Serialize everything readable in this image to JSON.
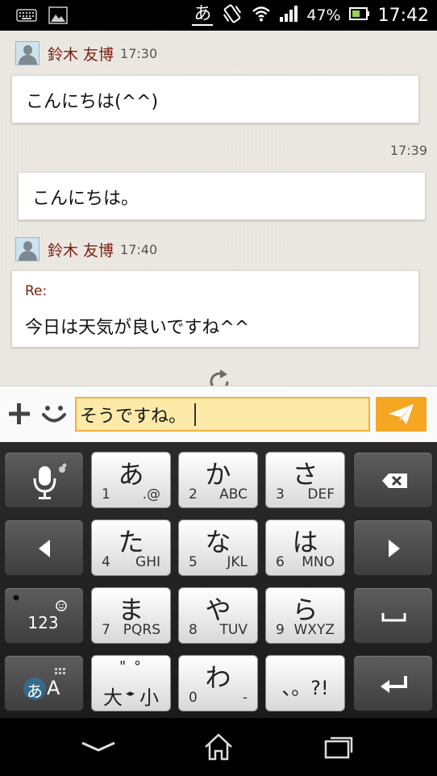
{
  "status_bar": {
    "ime_indicator": "あ",
    "battery_percent": "47%",
    "time": "17:42",
    "icons": [
      "keyboard-icon",
      "image-icon",
      "vibrate-icon",
      "wifi-icon",
      "signal-icon",
      "battery-icon"
    ]
  },
  "chat": {
    "messages": [
      {
        "sender": "鈴木 友博",
        "time": "17:30",
        "text": "こんにちは(^^)",
        "direction": "incoming"
      },
      {
        "time": "17:39",
        "text": "こんにちは。",
        "direction": "outgoing"
      },
      {
        "sender": "鈴木 友博",
        "time": "17:40",
        "reply_label": "Re:",
        "text": "今日は天気が良いですね^^",
        "direction": "incoming"
      }
    ]
  },
  "input": {
    "value": "そうですね。"
  },
  "keyboard": {
    "keys": [
      {
        "kana": "あ",
        "num": "1",
        "sub": ".@"
      },
      {
        "kana": "か",
        "num": "2",
        "sub": "ABC"
      },
      {
        "kana": "さ",
        "num": "3",
        "sub": "DEF"
      },
      {
        "kana": "た",
        "num": "4",
        "sub": "GHI"
      },
      {
        "kana": "な",
        "num": "5",
        "sub": "JKL"
      },
      {
        "kana": "は",
        "num": "6",
        "sub": "MNO"
      },
      {
        "kana": "ま",
        "num": "7",
        "sub": "PQRS"
      },
      {
        "kana": "や",
        "num": "8",
        "sub": "TUV"
      },
      {
        "kana": "ら",
        "num": "9",
        "sub": "WXYZ"
      },
      {
        "kana": "わ",
        "num": "0",
        "sub": "-"
      }
    ],
    "mode_123": "123",
    "mode_kana": "あ",
    "mode_alpha": "A",
    "dakuten": "\"  °",
    "size_toggle_big": "大",
    "size_toggle_small": "小",
    "punct": "、。?!"
  },
  "colors": {
    "accent": "#f5a623",
    "sender_name": "#7a1f12",
    "input_bg": "#fde9a8"
  }
}
